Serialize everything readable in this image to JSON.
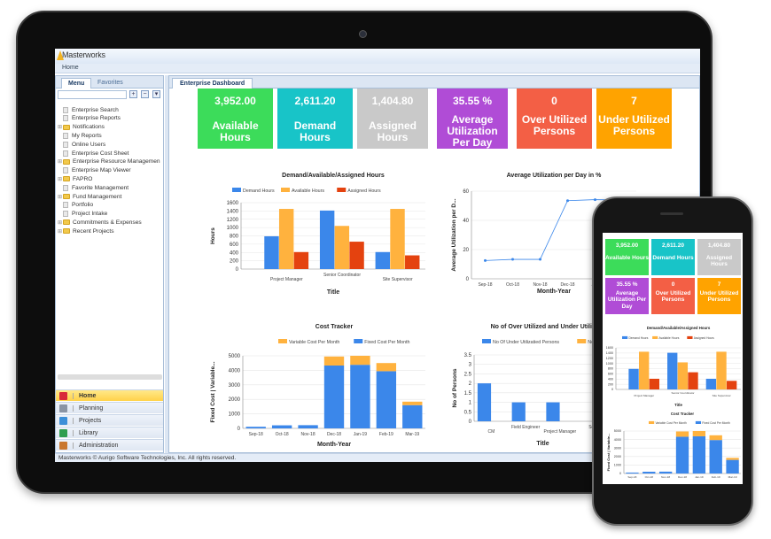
{
  "app": {
    "brand_small": "aurigo",
    "brand": "Masterworks",
    "breadcrumb": "Home",
    "footer": "Masterworks © Aurigo Software Technologies, Inc. All rights reserved."
  },
  "sidebar": {
    "tabs": [
      "Menu",
      "Favorites"
    ],
    "search_placeholder": "",
    "tree": [
      {
        "label": "Enterprise Search",
        "type": "doc"
      },
      {
        "label": "Enterprise Reports",
        "type": "doc"
      },
      {
        "label": "Notifications",
        "type": "folder"
      },
      {
        "label": "My Reports",
        "type": "doc"
      },
      {
        "label": "Online Users",
        "type": "doc"
      },
      {
        "label": "Enterprise Cost Sheet",
        "type": "doc"
      },
      {
        "label": "Enterprise Resource Managemen",
        "type": "folder"
      },
      {
        "label": "Enterprise Map Viewer",
        "type": "doc"
      },
      {
        "label": "FAPRO",
        "type": "folder"
      },
      {
        "label": "Favorite Management",
        "type": "doc"
      },
      {
        "label": "Fund Management",
        "type": "folder"
      },
      {
        "label": "Portfolio",
        "type": "doc"
      },
      {
        "label": "Project Intake",
        "type": "doc"
      },
      {
        "label": "Commitments & Expenses",
        "type": "folder"
      },
      {
        "label": "Recent Projects",
        "type": "folder"
      }
    ],
    "nav": [
      {
        "label": "Home",
        "active": true,
        "icon": "home-icon",
        "color": "#d8283a"
      },
      {
        "label": "Planning",
        "active": false,
        "icon": "planning-icon",
        "color": "#8a94a4"
      },
      {
        "label": "Projects",
        "active": false,
        "icon": "projects-icon",
        "color": "#3c8fd8"
      },
      {
        "label": "Library",
        "active": false,
        "icon": "library-icon",
        "color": "#2f9e4f"
      },
      {
        "label": "Administration",
        "active": false,
        "icon": "administration-icon",
        "color": "#c9772e"
      }
    ]
  },
  "main": {
    "tab": "Enterprise Dashboard"
  },
  "kpis": [
    {
      "value": "3,952.00",
      "label": "Available Hours",
      "color": "#3cdc5a"
    },
    {
      "value": "2,611.20",
      "label": "Demand Hours",
      "color": "#18c4c8"
    },
    {
      "value": "1,404.80",
      "label": "Assigned Hours",
      "color": "#c9c9c9"
    },
    {
      "value": "35.55 %",
      "label": "Average Utilization Per Day",
      "color": "#b04cd6"
    },
    {
      "value": "0",
      "label": "Over Utilized Persons",
      "color": "#f35f45"
    },
    {
      "value": "7",
      "label": "Under Utilized Persons",
      "color": "#ffa300"
    }
  ],
  "chart_data": [
    {
      "type": "bar",
      "title": "Demand/Available/Assigned Hours",
      "xlabel": "Title",
      "ylabel": "Hours",
      "categories": [
        "Project Manager",
        "Senior Coordinator",
        "Site Supervisor"
      ],
      "series": [
        {
          "name": "Demand Hours",
          "values": [
            790,
            1410,
            410
          ],
          "color": "#3b87ea"
        },
        {
          "name": "Available Hours",
          "values": [
            1450,
            1040,
            1450
          ],
          "color": "#ffb23e"
        },
        {
          "name": "Assigned Hours",
          "values": [
            410,
            660,
            330
          ],
          "color": "#e4420f"
        }
      ],
      "ylim": [
        0,
        1600
      ],
      "yticks": [
        0,
        200,
        400,
        600,
        800,
        1000,
        1200,
        1400,
        1600
      ],
      "legend": "top",
      "grid": true
    },
    {
      "type": "line",
      "title": "Average Utilization per Day in %",
      "xlabel": "Month-Year",
      "ylabel": "Average Utilization per D...",
      "categories": [
        "Sep-18",
        "Oct-18",
        "Nov-18",
        "Dec-18",
        "Jan",
        "Feb-19"
      ],
      "series": [
        {
          "values": [
            12.5,
            13.3,
            13.3,
            53.5,
            54.2,
            54.0
          ],
          "color": "#3b87ea"
        }
      ],
      "ylim": [
        0,
        60
      ],
      "yticks": [
        0,
        20,
        40,
        60
      ],
      "grid": true
    },
    {
      "type": "stacked-bar",
      "title": "Cost Tracker",
      "xlabel": "Month-Year",
      "ylabel": "Fixed Cost | Variable...",
      "categories": [
        "Sep-18",
        "Oct-18",
        "Nov-18",
        "Dec-18",
        "Jan-19",
        "Feb-19",
        "Mar-19"
      ],
      "series": [
        {
          "name": "Fixed Cost Per Month",
          "values": [
            110,
            210,
            220,
            4330,
            4380,
            3940,
            1600
          ],
          "color": "#3b87ea"
        },
        {
          "name": "Variable Cost Per Month",
          "values": [
            0,
            0,
            0,
            620,
            620,
            560,
            240
          ],
          "color": "#ffb23e"
        }
      ],
      "legend_order": [
        "Variable Cost Per Month",
        "Fixed Cost Per Month"
      ],
      "ylim": [
        0,
        5000
      ],
      "yticks": [
        0,
        1000,
        2000,
        3000,
        4000,
        5000
      ],
      "legend": "top-right",
      "grid": true
    },
    {
      "type": "bar",
      "title": "No of Over Utilized and Under Utiliz",
      "xlabel": "Title",
      "ylabel": "No of Persons",
      "categories": [
        "CM",
        "Field Engineer",
        "Project Manager",
        "Senio"
      ],
      "series": [
        {
          "name": "No Of Under Utilizatied Persons",
          "values": [
            2,
            1,
            1,
            0
          ],
          "color": "#3b87ea"
        },
        {
          "name": "No",
          "values": [
            0,
            0,
            0,
            0
          ],
          "color": "#ffb23e"
        }
      ],
      "ylim": [
        0,
        3.5
      ],
      "yticks": [
        0,
        0.5,
        1,
        1.5,
        2,
        2.5,
        3,
        3.5
      ],
      "legend": "top",
      "grid": true
    }
  ]
}
